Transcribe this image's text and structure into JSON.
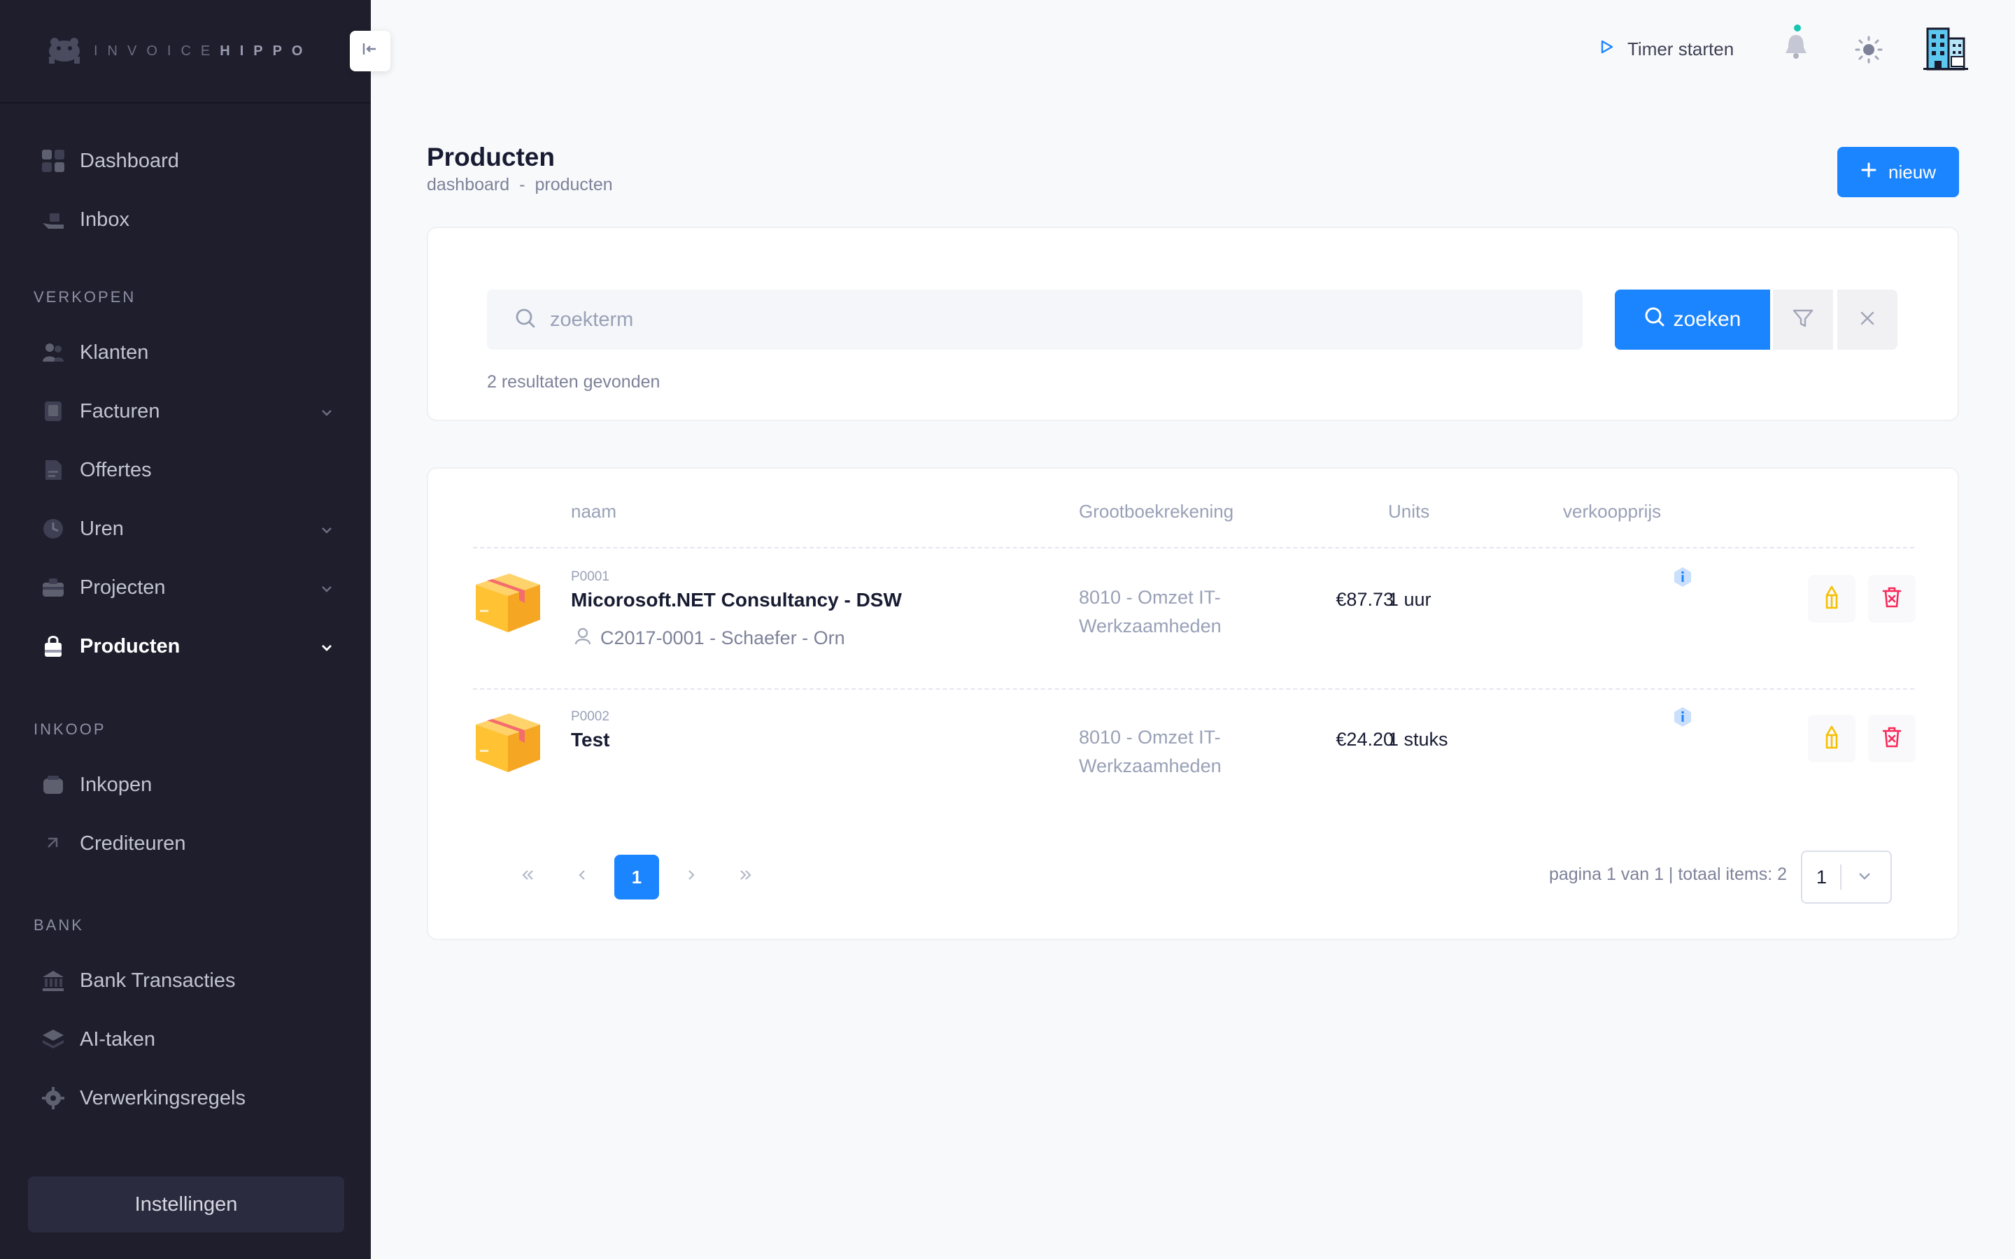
{
  "app": {
    "logo_light": "INVOICE",
    "logo_bold": "HIPPO"
  },
  "sidebar": {
    "items_top": [
      {
        "label": "Dashboard",
        "icon": "dashboard-icon"
      },
      {
        "label": "Inbox",
        "icon": "inbox-icon"
      }
    ],
    "sections": [
      {
        "label": "VERKOPEN",
        "items": [
          {
            "label": "Klanten",
            "icon": "customers-icon"
          },
          {
            "label": "Facturen",
            "icon": "invoice-icon",
            "expandable": true
          },
          {
            "label": "Offertes",
            "icon": "quote-icon"
          },
          {
            "label": "Uren",
            "icon": "clock-icon",
            "expandable": true
          },
          {
            "label": "Projecten",
            "icon": "projects-icon",
            "expandable": true
          },
          {
            "label": "Producten",
            "icon": "products-icon",
            "expandable": true,
            "active": true
          }
        ]
      },
      {
        "label": "INKOOP",
        "items": [
          {
            "label": "Inkopen",
            "icon": "purchases-icon"
          },
          {
            "label": "Crediteuren",
            "icon": "creditors-icon"
          }
        ]
      },
      {
        "label": "BANK",
        "items": [
          {
            "label": "Bank Transacties",
            "icon": "bank-icon"
          },
          {
            "label": "AI-taken",
            "icon": "layers-icon"
          },
          {
            "label": "Verwerkingsregels",
            "icon": "gear-icon"
          }
        ]
      }
    ],
    "settings_label": "Instellingen"
  },
  "topbar": {
    "timer_label": "Timer starten"
  },
  "page": {
    "title": "Producten",
    "breadcrumb": [
      "dashboard",
      "-",
      "producten"
    ],
    "new_button": "nieuw"
  },
  "search": {
    "placeholder": "zoekterm",
    "value": "",
    "button_label": "zoeken",
    "results_text": "2 resultaten gevonden"
  },
  "table": {
    "columns": [
      "naam",
      "Grootboekrekening",
      "Units",
      "verkoopprijs"
    ],
    "rows": [
      {
        "code": "P0001",
        "name": "Micorosoft.NET Consultancy - DSW",
        "client": "C2017-0001 - Schaefer - Orn",
        "ledger": "8010 - Omzet IT-Werkzaamheden",
        "units": "1 uur",
        "price": "€87.73"
      },
      {
        "code": "P0002",
        "name": "Test",
        "client": "",
        "ledger": "8010 - Omzet IT-Werkzaamheden",
        "units": "1 stuks",
        "price": "€24.20"
      }
    ]
  },
  "pagination": {
    "current": "1",
    "info": "pagina 1 van 1 | totaal items: 2",
    "page_size": "1"
  },
  "colors": {
    "primary": "#1b84ff",
    "sidebar_bg": "#1e1e2d",
    "danger": "#f8285a",
    "warning": "#f6c000"
  }
}
